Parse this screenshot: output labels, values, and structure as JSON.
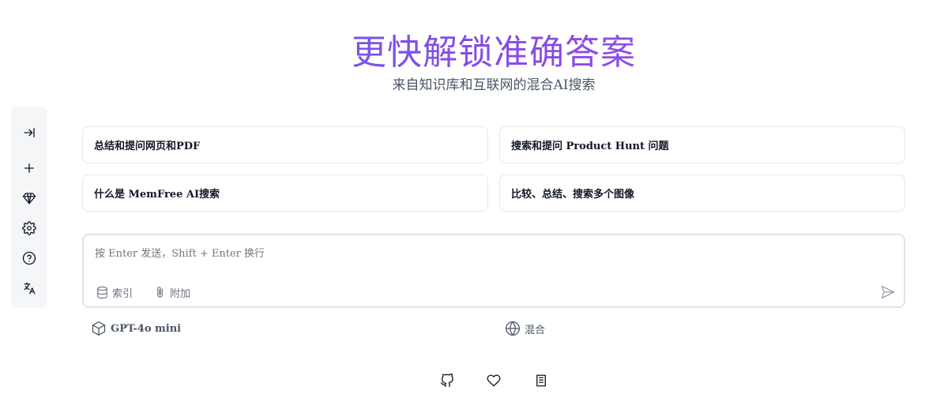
{
  "hero": {
    "title": "更快解锁准确答案",
    "subtitle": "来自知识库和互联网的混合AI搜索"
  },
  "sidebar": {
    "items": [
      {
        "icon": "collapse-icon"
      },
      {
        "icon": "plus-icon"
      },
      {
        "icon": "diamond-icon"
      },
      {
        "icon": "gear-icon"
      },
      {
        "icon": "help-circle-icon"
      },
      {
        "icon": "translate-icon"
      }
    ]
  },
  "suggestions": [
    "总结和提问网页和PDF",
    "搜索和提问 Product Hunt 问题",
    "什么是 MemFree AI搜索",
    "比较、总结、搜索多个图像"
  ],
  "input": {
    "placeholder": "按 Enter 发送，Shift + Enter 换行",
    "index_label": "索引",
    "attach_label": "附加"
  },
  "options": {
    "model": "GPT-4o mini",
    "mode": "混合"
  },
  "footer": {
    "icons": [
      "github-icon",
      "heart-icon",
      "book-icon"
    ]
  }
}
